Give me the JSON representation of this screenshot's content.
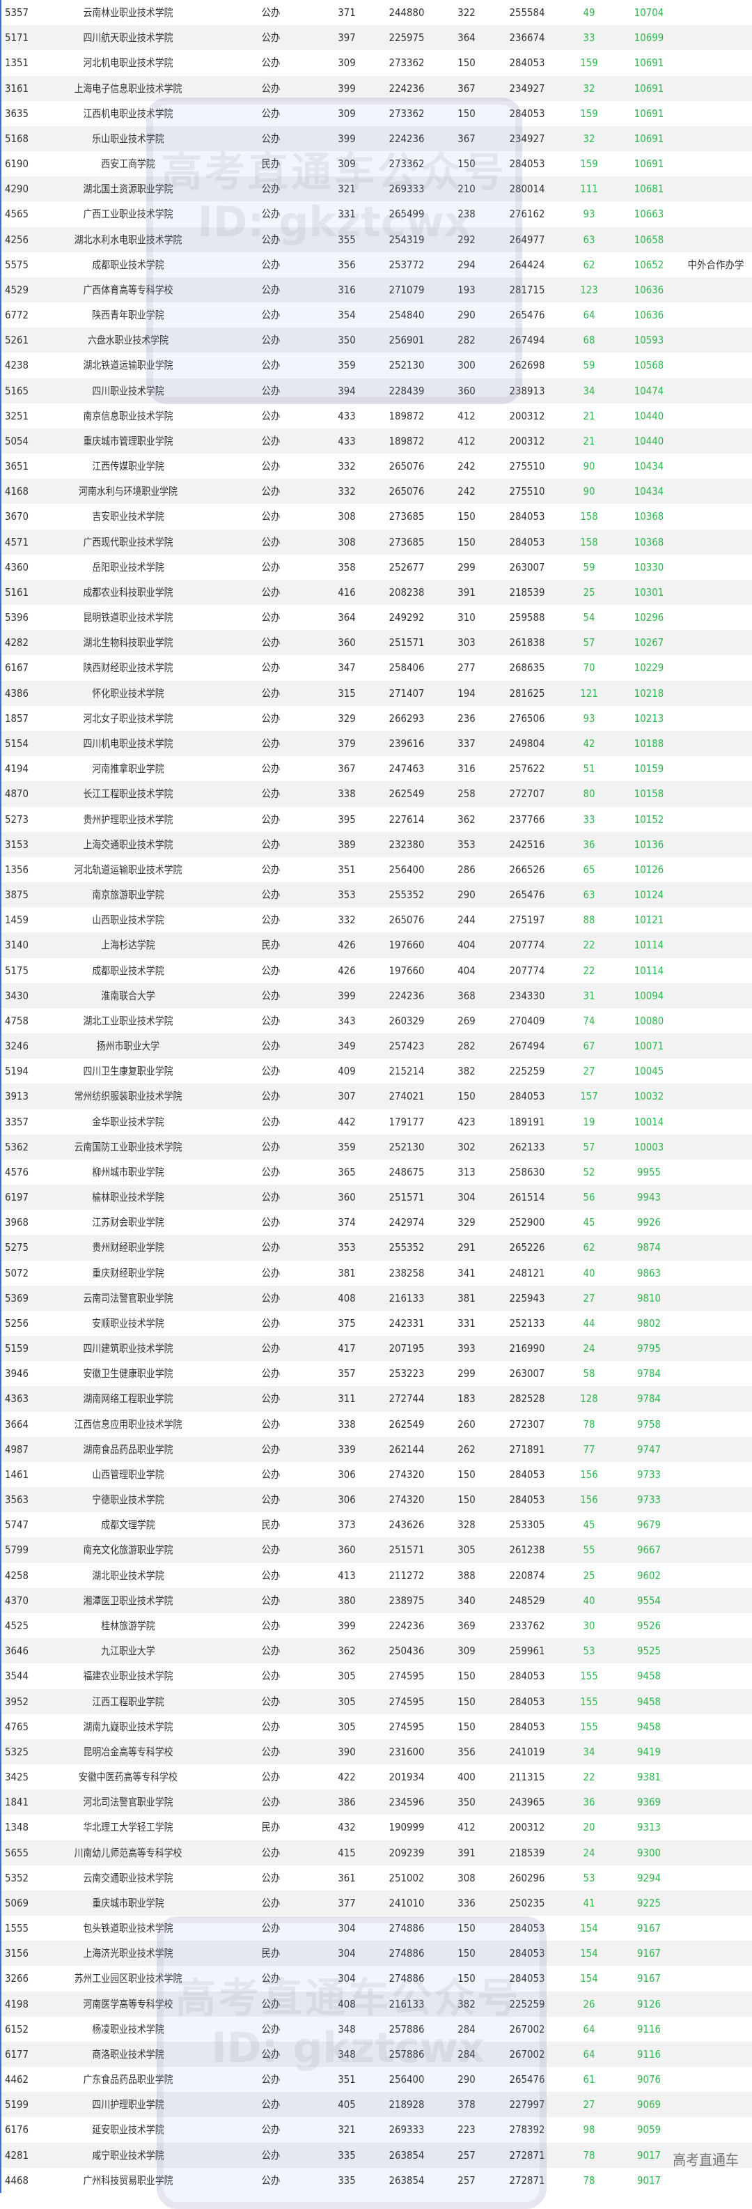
{
  "colors": {
    "accent_green": "#2db84d",
    "alt_row": "#f2f2f2",
    "left_border": "#3b6fd8"
  },
  "watermark": {
    "line1": "高考直通车公众号",
    "line2": "ID: gkztcwx",
    "corner": "高考直通车"
  },
  "rows": [
    [
      "5357",
      "云南林业职业技术学院",
      "公办",
      "371",
      "244880",
      "322",
      "255584",
      "49",
      "10704",
      ""
    ],
    [
      "5171",
      "四川航天职业技术学院",
      "公办",
      "397",
      "225975",
      "364",
      "236674",
      "33",
      "10699",
      ""
    ],
    [
      "1351",
      "河北机电职业技术学院",
      "公办",
      "309",
      "273362",
      "150",
      "284053",
      "159",
      "10691",
      ""
    ],
    [
      "3161",
      "上海电子信息职业技术学院",
      "公办",
      "399",
      "224236",
      "367",
      "234927",
      "32",
      "10691",
      ""
    ],
    [
      "3635",
      "江西机电职业技术学院",
      "公办",
      "309",
      "273362",
      "150",
      "284053",
      "159",
      "10691",
      ""
    ],
    [
      "5168",
      "乐山职业技术学院",
      "公办",
      "399",
      "224236",
      "367",
      "234927",
      "32",
      "10691",
      ""
    ],
    [
      "6190",
      "西安工商学院",
      "民办",
      "309",
      "273362",
      "150",
      "284053",
      "159",
      "10691",
      ""
    ],
    [
      "4290",
      "湖北国土资源职业学院",
      "公办",
      "321",
      "269333",
      "210",
      "280014",
      "111",
      "10681",
      ""
    ],
    [
      "4565",
      "广西工业职业技术学院",
      "公办",
      "331",
      "265499",
      "238",
      "276162",
      "93",
      "10663",
      ""
    ],
    [
      "4256",
      "湖北水利水电职业技术学院",
      "公办",
      "355",
      "254319",
      "292",
      "264977",
      "63",
      "10658",
      ""
    ],
    [
      "5575",
      "成都职业技术学院",
      "公办",
      "356",
      "253772",
      "294",
      "264424",
      "62",
      "10652",
      "中外合作办学"
    ],
    [
      "4529",
      "广西体育高等专科学校",
      "公办",
      "316",
      "271079",
      "193",
      "281715",
      "123",
      "10636",
      ""
    ],
    [
      "6772",
      "陕西青年职业学院",
      "公办",
      "354",
      "254840",
      "290",
      "265476",
      "64",
      "10636",
      ""
    ],
    [
      "5261",
      "六盘水职业技术学院",
      "公办",
      "350",
      "256901",
      "282",
      "267494",
      "68",
      "10593",
      ""
    ],
    [
      "4238",
      "湖北铁道运输职业学院",
      "公办",
      "359",
      "252130",
      "300",
      "262698",
      "59",
      "10568",
      ""
    ],
    [
      "5165",
      "四川职业技术学院",
      "公办",
      "394",
      "228439",
      "360",
      "238913",
      "34",
      "10474",
      ""
    ],
    [
      "3251",
      "南京信息职业技术学院",
      "公办",
      "433",
      "189872",
      "412",
      "200312",
      "21",
      "10440",
      ""
    ],
    [
      "5054",
      "重庆城市管理职业学院",
      "公办",
      "433",
      "189872",
      "412",
      "200312",
      "21",
      "10440",
      ""
    ],
    [
      "3651",
      "江西传媒职业学院",
      "公办",
      "332",
      "265076",
      "242",
      "275510",
      "90",
      "10434",
      ""
    ],
    [
      "4168",
      "河南水利与环境职业学院",
      "公办",
      "332",
      "265076",
      "242",
      "275510",
      "90",
      "10434",
      ""
    ],
    [
      "3670",
      "吉安职业技术学院",
      "公办",
      "308",
      "273685",
      "150",
      "284053",
      "158",
      "10368",
      ""
    ],
    [
      "4571",
      "广西现代职业技术学院",
      "公办",
      "308",
      "273685",
      "150",
      "284053",
      "158",
      "10368",
      ""
    ],
    [
      "4360",
      "岳阳职业技术学院",
      "公办",
      "358",
      "252677",
      "299",
      "263007",
      "59",
      "10330",
      ""
    ],
    [
      "5161",
      "成都农业科技职业学院",
      "公办",
      "416",
      "208238",
      "391",
      "218539",
      "25",
      "10301",
      ""
    ],
    [
      "5396",
      "昆明铁道职业技术学院",
      "公办",
      "364",
      "249292",
      "310",
      "259588",
      "54",
      "10296",
      ""
    ],
    [
      "4282",
      "湖北生物科技职业学院",
      "公办",
      "360",
      "251571",
      "303",
      "261838",
      "57",
      "10267",
      ""
    ],
    [
      "6167",
      "陕西财经职业技术学院",
      "公办",
      "347",
      "258406",
      "277",
      "268635",
      "70",
      "10229",
      ""
    ],
    [
      "4386",
      "怀化职业技术学院",
      "公办",
      "315",
      "271407",
      "194",
      "281625",
      "121",
      "10218",
      ""
    ],
    [
      "1857",
      "河北女子职业技术学院",
      "公办",
      "329",
      "266293",
      "236",
      "276506",
      "93",
      "10213",
      ""
    ],
    [
      "5154",
      "四川机电职业技术学院",
      "公办",
      "379",
      "239616",
      "337",
      "249804",
      "42",
      "10188",
      ""
    ],
    [
      "4194",
      "河南推拿职业学院",
      "公办",
      "367",
      "247463",
      "316",
      "257622",
      "51",
      "10159",
      ""
    ],
    [
      "4870",
      "长江工程职业技术学院",
      "公办",
      "338",
      "262549",
      "258",
      "272707",
      "80",
      "10158",
      ""
    ],
    [
      "5273",
      "贵州护理职业技术学院",
      "公办",
      "395",
      "227614",
      "362",
      "237766",
      "33",
      "10152",
      ""
    ],
    [
      "3153",
      "上海交通职业技术学院",
      "公办",
      "389",
      "232380",
      "353",
      "242516",
      "36",
      "10136",
      ""
    ],
    [
      "1356",
      "河北轨道运输职业技术学院",
      "公办",
      "351",
      "256400",
      "286",
      "266526",
      "65",
      "10126",
      ""
    ],
    [
      "3875",
      "南京旅游职业学院",
      "公办",
      "353",
      "255352",
      "290",
      "265476",
      "63",
      "10124",
      ""
    ],
    [
      "1459",
      "山西职业技术学院",
      "公办",
      "332",
      "265076",
      "244",
      "275197",
      "88",
      "10121",
      ""
    ],
    [
      "3140",
      "上海杉达学院",
      "民办",
      "426",
      "197660",
      "404",
      "207774",
      "22",
      "10114",
      ""
    ],
    [
      "5175",
      "成都职业技术学院",
      "公办",
      "426",
      "197660",
      "404",
      "207774",
      "22",
      "10114",
      ""
    ],
    [
      "3430",
      "淮南联合大学",
      "公办",
      "399",
      "224236",
      "368",
      "234330",
      "31",
      "10094",
      ""
    ],
    [
      "4758",
      "湖北工业职业技术学院",
      "公办",
      "343",
      "260329",
      "269",
      "270409",
      "74",
      "10080",
      ""
    ],
    [
      "3246",
      "扬州市职业大学",
      "公办",
      "349",
      "257423",
      "282",
      "267494",
      "67",
      "10071",
      ""
    ],
    [
      "5194",
      "四川卫生康复职业学院",
      "公办",
      "409",
      "215214",
      "382",
      "225259",
      "27",
      "10045",
      ""
    ],
    [
      "3913",
      "常州纺织服装职业技术学院",
      "公办",
      "307",
      "274021",
      "150",
      "284053",
      "157",
      "10032",
      ""
    ],
    [
      "3357",
      "金华职业技术学院",
      "公办",
      "442",
      "179177",
      "423",
      "189191",
      "19",
      "10014",
      ""
    ],
    [
      "5362",
      "云南国防工业职业技术学院",
      "公办",
      "359",
      "252130",
      "302",
      "262133",
      "57",
      "10003",
      ""
    ],
    [
      "4576",
      "柳州城市职业学院",
      "公办",
      "365",
      "248675",
      "313",
      "258630",
      "52",
      "9955",
      ""
    ],
    [
      "6197",
      "榆林职业技术学院",
      "公办",
      "360",
      "251571",
      "304",
      "261514",
      "56",
      "9943",
      ""
    ],
    [
      "3968",
      "江苏财会职业学院",
      "公办",
      "374",
      "242974",
      "329",
      "252900",
      "45",
      "9926",
      ""
    ],
    [
      "5275",
      "贵州财经职业学院",
      "公办",
      "353",
      "255352",
      "291",
      "265226",
      "62",
      "9874",
      ""
    ],
    [
      "5072",
      "重庆财经职业学院",
      "公办",
      "381",
      "238258",
      "341",
      "248121",
      "40",
      "9863",
      ""
    ],
    [
      "5369",
      "云南司法警官职业学院",
      "公办",
      "408",
      "216133",
      "381",
      "225943",
      "27",
      "9810",
      ""
    ],
    [
      "5256",
      "安顺职业技术学院",
      "公办",
      "375",
      "242331",
      "331",
      "252133",
      "44",
      "9802",
      ""
    ],
    [
      "5159",
      "四川建筑职业技术学院",
      "公办",
      "417",
      "207195",
      "393",
      "216990",
      "24",
      "9795",
      ""
    ],
    [
      "3946",
      "安徽卫生健康职业学院",
      "公办",
      "357",
      "253223",
      "299",
      "263007",
      "58",
      "9784",
      ""
    ],
    [
      "4363",
      "湖南网络工程职业学院",
      "公办",
      "311",
      "272744",
      "183",
      "282528",
      "128",
      "9784",
      ""
    ],
    [
      "3664",
      "江西信息应用职业技术学院",
      "公办",
      "338",
      "262549",
      "260",
      "272307",
      "78",
      "9758",
      ""
    ],
    [
      "4987",
      "湖南食品药品职业学院",
      "公办",
      "339",
      "262144",
      "262",
      "271891",
      "77",
      "9747",
      ""
    ],
    [
      "1461",
      "山西管理职业学院",
      "公办",
      "306",
      "274320",
      "150",
      "284053",
      "156",
      "9733",
      ""
    ],
    [
      "3563",
      "宁德职业技术学院",
      "公办",
      "306",
      "274320",
      "150",
      "284053",
      "156",
      "9733",
      ""
    ],
    [
      "5747",
      "成都文理学院",
      "民办",
      "373",
      "243626",
      "328",
      "253305",
      "45",
      "9679",
      ""
    ],
    [
      "5799",
      "南充文化旅游职业学院",
      "公办",
      "360",
      "251571",
      "305",
      "261238",
      "55",
      "9667",
      ""
    ],
    [
      "4258",
      "湖北职业技术学院",
      "公办",
      "413",
      "211272",
      "388",
      "220874",
      "25",
      "9602",
      ""
    ],
    [
      "4370",
      "湘潭医卫职业技术学院",
      "公办",
      "380",
      "238975",
      "340",
      "248529",
      "40",
      "9554",
      ""
    ],
    [
      "4525",
      "桂林旅游学院",
      "公办",
      "399",
      "224236",
      "369",
      "233762",
      "30",
      "9526",
      ""
    ],
    [
      "3646",
      "九江职业大学",
      "公办",
      "362",
      "250436",
      "309",
      "259961",
      "53",
      "9525",
      ""
    ],
    [
      "3544",
      "福建农业职业技术学院",
      "公办",
      "305",
      "274595",
      "150",
      "284053",
      "155",
      "9458",
      ""
    ],
    [
      "3952",
      "江西工程职业学院",
      "公办",
      "305",
      "274595",
      "150",
      "284053",
      "155",
      "9458",
      ""
    ],
    [
      "4765",
      "湖南九嶷职业技术学院",
      "公办",
      "305",
      "274595",
      "150",
      "284053",
      "155",
      "9458",
      ""
    ],
    [
      "5325",
      "昆明冶金高等专科学校",
      "公办",
      "390",
      "231600",
      "356",
      "241019",
      "34",
      "9419",
      ""
    ],
    [
      "3425",
      "安徽中医药高等专科学校",
      "公办",
      "422",
      "201934",
      "400",
      "211315",
      "22",
      "9381",
      ""
    ],
    [
      "1841",
      "河北司法警官职业学院",
      "公办",
      "386",
      "234596",
      "350",
      "243965",
      "36",
      "9369",
      ""
    ],
    [
      "1348",
      "华北理工大学轻工学院",
      "民办",
      "432",
      "190999",
      "412",
      "200312",
      "20",
      "9313",
      ""
    ],
    [
      "5655",
      "川南幼儿师范高等专科学校",
      "公办",
      "415",
      "209239",
      "391",
      "218539",
      "24",
      "9300",
      ""
    ],
    [
      "5352",
      "云南交通职业技术学院",
      "公办",
      "361",
      "251002",
      "308",
      "260296",
      "53",
      "9294",
      ""
    ],
    [
      "5069",
      "重庆城市职业学院",
      "公办",
      "377",
      "241010",
      "336",
      "250235",
      "41",
      "9225",
      ""
    ],
    [
      "1555",
      "包头铁道职业技术学院",
      "公办",
      "304",
      "274886",
      "150",
      "284053",
      "154",
      "9167",
      ""
    ],
    [
      "3156",
      "上海济光职业技术学院",
      "民办",
      "304",
      "274886",
      "150",
      "284053",
      "154",
      "9167",
      ""
    ],
    [
      "3266",
      "苏州工业园区职业技术学院",
      "公办",
      "304",
      "274886",
      "150",
      "284053",
      "154",
      "9167",
      ""
    ],
    [
      "4198",
      "河南医学高等专科学校",
      "公办",
      "408",
      "216133",
      "382",
      "225259",
      "26",
      "9126",
      ""
    ],
    [
      "6152",
      "杨凌职业技术学院",
      "公办",
      "348",
      "257886",
      "284",
      "267002",
      "64",
      "9116",
      ""
    ],
    [
      "6177",
      "商洛职业技术学院",
      "公办",
      "348",
      "257886",
      "284",
      "267002",
      "64",
      "9116",
      ""
    ],
    [
      "4462",
      "广东食品药品职业学院",
      "公办",
      "351",
      "256400",
      "290",
      "265476",
      "61",
      "9076",
      ""
    ],
    [
      "5199",
      "四川护理职业学院",
      "公办",
      "405",
      "218928",
      "378",
      "227997",
      "27",
      "9069",
      ""
    ],
    [
      "6176",
      "延安职业技术学院",
      "公办",
      "321",
      "269333",
      "223",
      "278392",
      "98",
      "9059",
      ""
    ],
    [
      "4281",
      "咸宁职业技术学院",
      "公办",
      "335",
      "263854",
      "257",
      "272871",
      "78",
      "9017",
      ""
    ],
    [
      "4468",
      "广州科技贸易职业学院",
      "公办",
      "335",
      "263854",
      "257",
      "272871",
      "78",
      "9017",
      ""
    ]
  ]
}
